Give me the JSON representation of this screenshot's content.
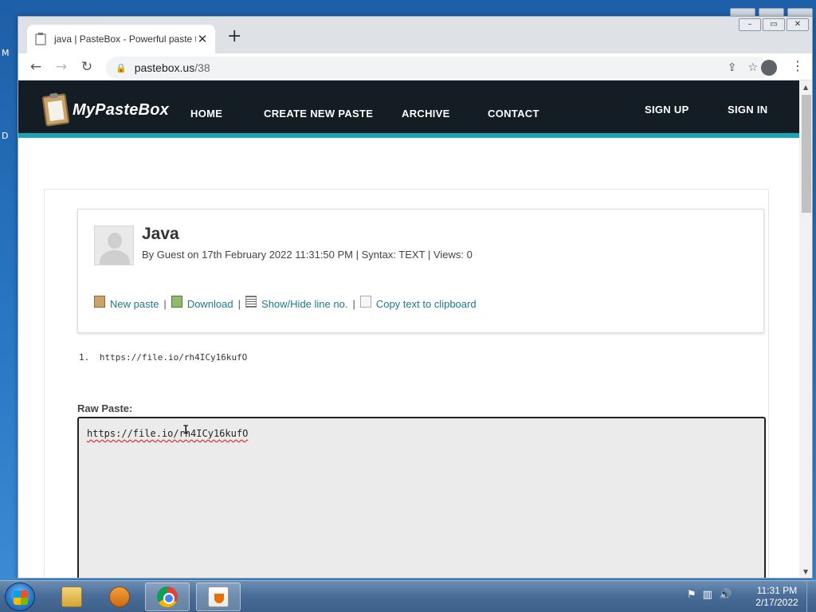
{
  "desktop": {
    "side_glyphs": [
      "M",
      "D"
    ]
  },
  "browser": {
    "tab_title": "java | PasteBox - Powerful paste t",
    "tab_close": "✕",
    "new_tab": "+",
    "url_host": "pastebox.us",
    "url_path": "/38",
    "back": "←",
    "forward": "→",
    "reload": "↻",
    "lock": "🔒",
    "share": "⇪",
    "star": "☆",
    "menu": "⋮",
    "win_minimize": "–",
    "win_maximize": "▭",
    "win_close": "✕"
  },
  "site": {
    "logo_text": "MyPasteBox",
    "nav": [
      "HOME",
      "CREATE NEW PASTE",
      "ARCHIVE",
      "CONTACT"
    ],
    "auth": [
      "SIGN UP",
      "SIGN IN"
    ]
  },
  "paste": {
    "title": "Java",
    "meta": "By Guest on 17th February 2022 11:31:50 PM | Syntax: TEXT | Views: 0",
    "actions": [
      "New paste",
      "Download",
      "Show/Hide line no.",
      "Copy text to clipboard"
    ],
    "separator": "|",
    "lines": [
      {
        "num": "1.",
        "text": "https://file.io/rh4ICy16kufO"
      }
    ],
    "raw_label": "Raw Paste:",
    "raw_text": "https://file.io/rh4ICy16kufO"
  },
  "taskbar": {
    "time": "11:31 PM",
    "date": "2/17/2022",
    "tray_icons": [
      "⚑",
      "▥",
      "🔊"
    ]
  },
  "colors": {
    "header_bg": "#141d24",
    "accent": "#1aa3b5",
    "link": "#1b7a8c"
  }
}
